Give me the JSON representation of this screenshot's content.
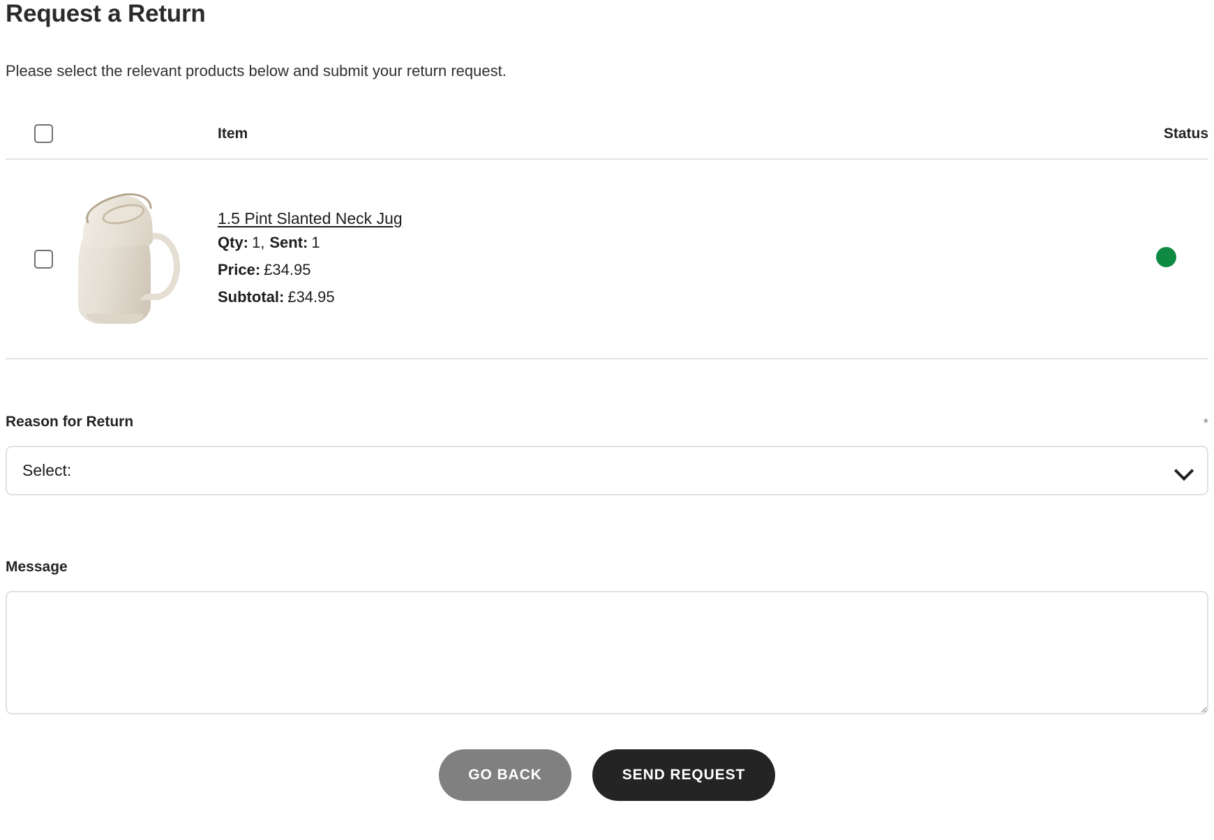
{
  "header": {
    "title": "Request a Return",
    "subtitle": "Please select the relevant products below and submit your return request."
  },
  "table": {
    "columns": {
      "select": "",
      "item": "Item",
      "status": "Status"
    },
    "select_all_checked": false,
    "rows": [
      {
        "checked": false,
        "product_name": "1.5 Pint Slanted Neck Jug",
        "qty_label": "Qty:",
        "qty_value": "1,",
        "sent_label": "Sent:",
        "sent_value": "1",
        "price_label": "Price:",
        "price_value": "£34.95",
        "subtotal_label": "Subtotal:",
        "subtotal_value": "£34.95",
        "status_color": "#0f8a42",
        "image_alt": "1.5 Pint Slanted Neck Jug"
      }
    ]
  },
  "form": {
    "reason": {
      "label": "Reason for Return",
      "required_marker": "*",
      "selected_value": "Select:",
      "options": [
        "Select:"
      ]
    },
    "message": {
      "label": "Message",
      "value": "",
      "placeholder": ""
    }
  },
  "actions": {
    "go_back": "GO BACK",
    "send_request": "SEND REQUEST"
  },
  "colors": {
    "status_green": "#0f8a42",
    "primary_button": "#242424",
    "secondary_button": "#808080",
    "divider": "#e3e3e3",
    "field_border": "#e0e0e0"
  },
  "icons": {
    "chevron_down": "chevron-down-icon",
    "resize_grip": "resize-grip-icon"
  }
}
